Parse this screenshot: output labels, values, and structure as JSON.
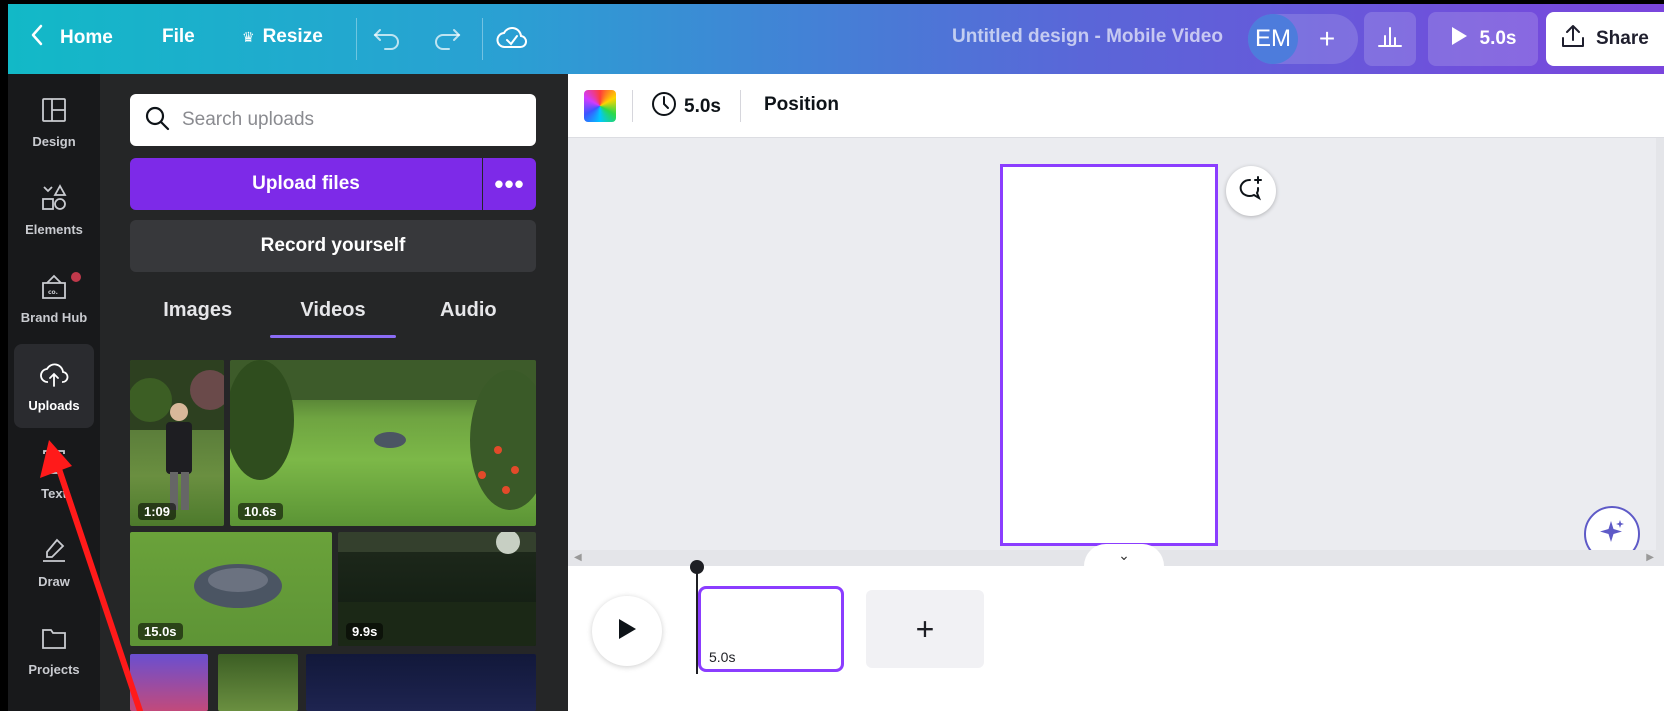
{
  "topbar": {
    "home_label": "Home",
    "file_label": "File",
    "resize_label": "Resize",
    "design_title": "Untitled design - Mobile Video",
    "avatar_initials": "EM",
    "avatar_plus": "+",
    "play_duration": "5.0s",
    "share_label": "Share"
  },
  "rail": {
    "items": [
      {
        "label": "Design"
      },
      {
        "label": "Elements"
      },
      {
        "label": "Brand Hub"
      },
      {
        "label": "Uploads"
      },
      {
        "label": "Text"
      },
      {
        "label": "Draw"
      },
      {
        "label": "Projects"
      }
    ],
    "active": "Uploads"
  },
  "panel": {
    "search_placeholder": "Search uploads",
    "upload_label": "Upload files",
    "more_label": "•••",
    "record_label": "Record yourself",
    "tabs": [
      {
        "label": "Images"
      },
      {
        "label": "Videos"
      },
      {
        "label": "Audio"
      }
    ],
    "active_tab": "Videos",
    "videos": [
      {
        "duration": "1:09"
      },
      {
        "duration": "10.6s"
      },
      {
        "duration": "15.0s"
      },
      {
        "duration": "9.9s"
      }
    ]
  },
  "context_bar": {
    "duration": "5.0s",
    "position_label": "Position"
  },
  "timeline": {
    "clip_duration": "5.0s",
    "add_label": "+"
  },
  "colors": {
    "accent": "#8b3dff",
    "upload_button": "#7d2ae8",
    "annotation_arrow": "#ff0000"
  }
}
